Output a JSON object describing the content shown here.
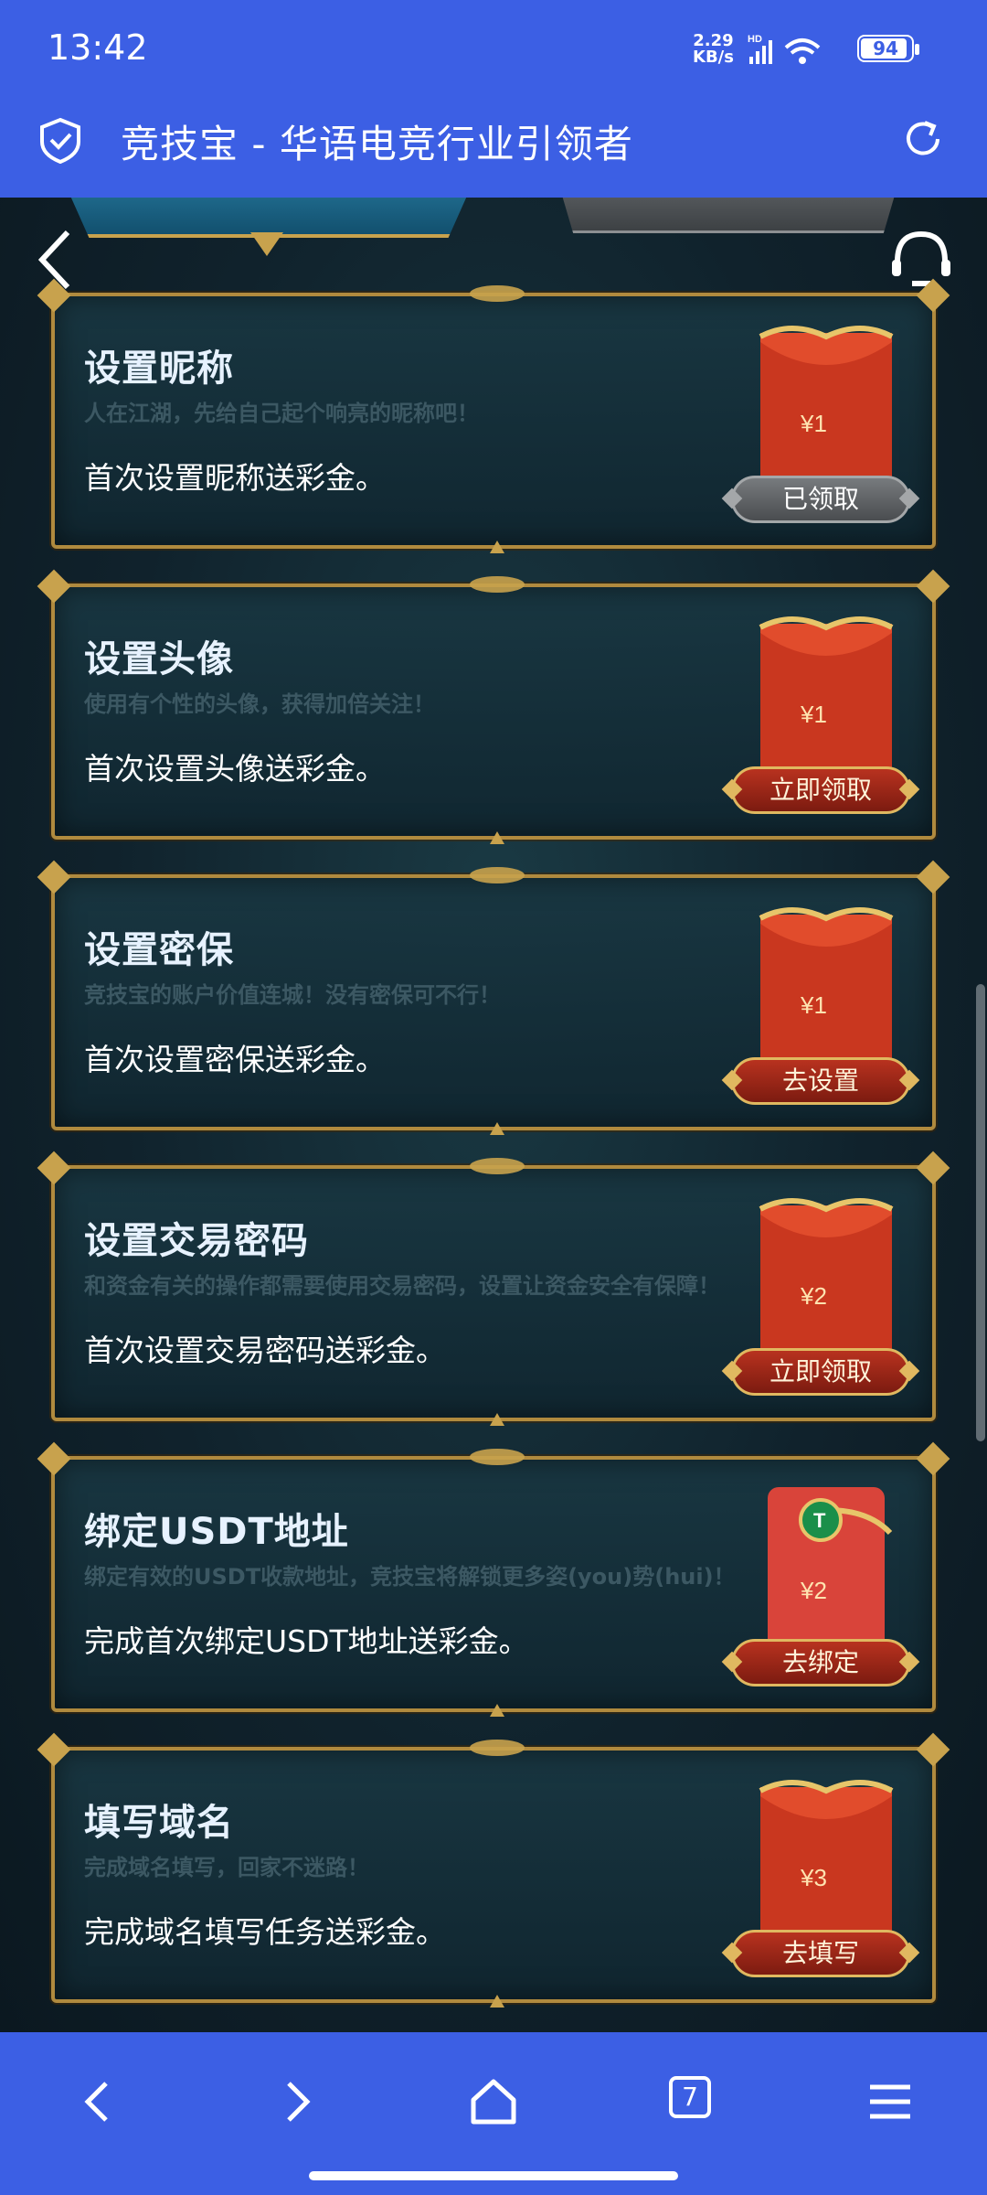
{
  "status_bar": {
    "time": "13:42",
    "net_speed_value": "2.29",
    "net_speed_unit": "KB/s",
    "network_type": "HD",
    "battery": "94"
  },
  "header": {
    "title": "竞技宝 - 华语电竞行业引领者",
    "icons": [
      "shield-check-icon",
      "refresh-icon"
    ]
  },
  "page": {
    "icons": [
      "back-icon",
      "headset-icon"
    ]
  },
  "tasks": [
    {
      "name": "设置昵称",
      "subtitle": "人在江湖，先给自己起个响亮的昵称吧！",
      "description": "首次设置昵称送彩金。",
      "reward": "¥1",
      "button": "已领取",
      "status": "done",
      "envelope": "red"
    },
    {
      "name": "设置头像",
      "subtitle": "使用有个性的头像，获得加倍关注！",
      "description": "首次设置头像送彩金。",
      "reward": "¥1",
      "button": "立即领取",
      "status": "claim",
      "envelope": "red"
    },
    {
      "name": "设置密保",
      "subtitle": "竞技宝的账户价值连城！没有密保可不行！",
      "description": "首次设置密保送彩金。",
      "reward": "¥1",
      "button": "去设置",
      "status": "todo",
      "envelope": "red"
    },
    {
      "name": "设置交易密码",
      "subtitle": "和资金有关的操作都需要使用交易密码，设置让资金安全有保障！",
      "description": "首次设置交易密码送彩金。",
      "reward": "¥2",
      "button": "立即领取",
      "status": "claim",
      "envelope": "red"
    },
    {
      "name": "绑定USDT地址",
      "subtitle": "绑定有效的USDT收款地址，竞技宝将解锁更多姿(you)势(hui)！",
      "description": "完成首次绑定USDT地址送彩金。",
      "reward": "¥2",
      "button": "去绑定",
      "status": "todo",
      "envelope": "usdt"
    },
    {
      "name": "填写域名",
      "subtitle": "完成域名填写，回家不迷路！",
      "description": "完成域名填写任务送彩金。",
      "reward": "¥3",
      "button": "去填写",
      "status": "todo",
      "envelope": "red"
    }
  ],
  "bottom_nav": {
    "tabs_count": "7",
    "icons": [
      "back-arrow-icon",
      "forward-arrow-icon",
      "home-icon",
      "tabs-icon",
      "menu-icon"
    ]
  },
  "colors": {
    "brand_blue": "#3c5fe4",
    "gold_border": "#b08a3e",
    "envelope_red": "#c9371f",
    "background": "#10222c"
  }
}
